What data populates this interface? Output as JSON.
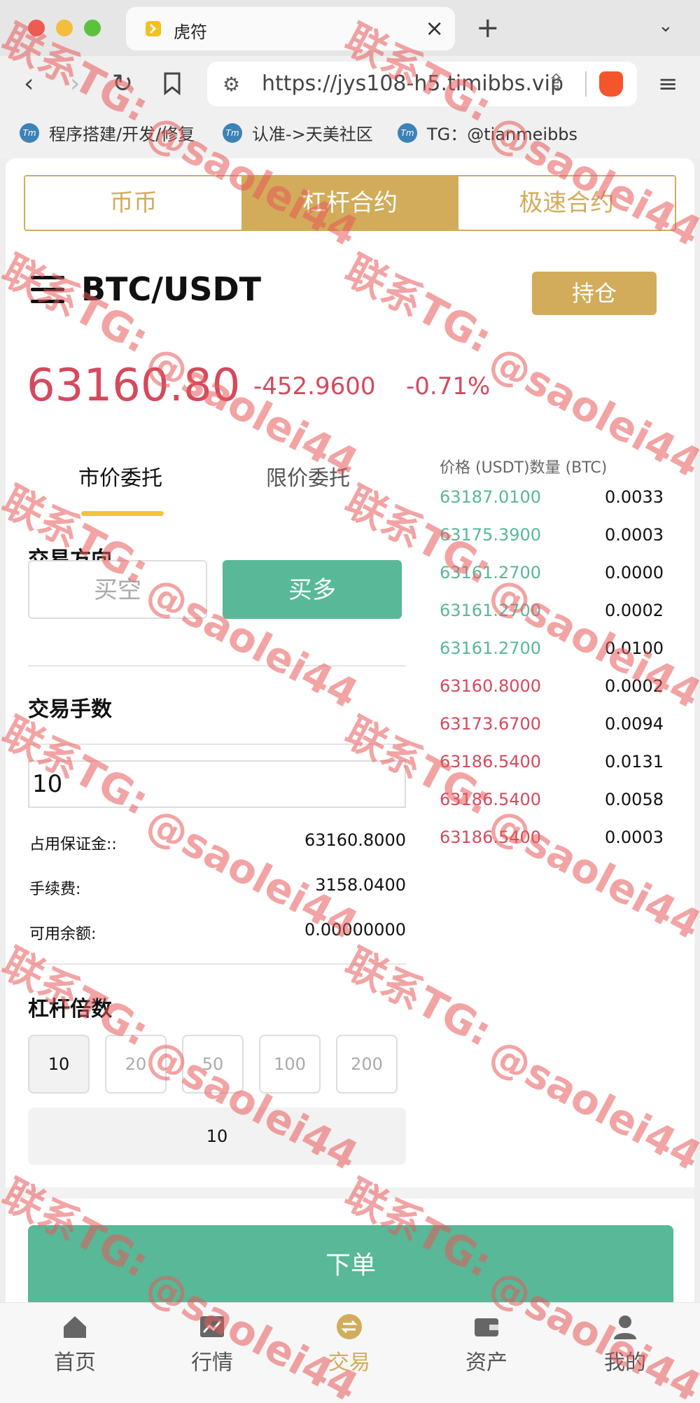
{
  "browser": {
    "tab_title": "虎符",
    "url": "https://jys108-h5.timibbs.vip",
    "bookmarks": [
      {
        "icon": "Tm",
        "label": "程序搭建/开发/修复"
      },
      {
        "icon": "Tm",
        "label": "认准->天美社区"
      },
      {
        "icon": "Tm",
        "label": "TG：@tianmeibbs"
      }
    ]
  },
  "mode_tabs": [
    "币币",
    "杠杆合约",
    "极速合约"
  ],
  "header": {
    "pair": "BTC/USDT",
    "hold_button": "持仓"
  },
  "ticker": {
    "price": "63160.80",
    "change": "-452.9600",
    "change_pct": "-0.71%"
  },
  "order_tabs": [
    "市价委托",
    "限价委托"
  ],
  "direction": {
    "title": "交易方向",
    "short_label": "买空",
    "long_label": "买多"
  },
  "quantity": {
    "title": "交易手数",
    "value": "10"
  },
  "info": {
    "margin_label": "占用保证金::",
    "margin_value": "63160.8000",
    "fee_label": "手续费:",
    "fee_value": "3158.0400",
    "balance_label": "可用余额:",
    "balance_value": "0.00000000"
  },
  "leverage": {
    "title": "杠杆倍数",
    "options": [
      "10",
      "20",
      "50",
      "100",
      "200"
    ],
    "selected": "10"
  },
  "order_book": {
    "header": "价格 (USDT)数量 (BTC)",
    "asks_color": "#58b898",
    "bids_color": "#d44a5c",
    "rows": [
      {
        "price": "63187.0100",
        "qty": "0.0033",
        "side": "green"
      },
      {
        "price": "63175.3900",
        "qty": "0.0003",
        "side": "green"
      },
      {
        "price": "63161.2700",
        "qty": "0.0000",
        "side": "green"
      },
      {
        "price": "63161.2700",
        "qty": "0.0002",
        "side": "green"
      },
      {
        "price": "63161.2700",
        "qty": "0.0100",
        "side": "green"
      },
      {
        "price": "63160.8000",
        "qty": "0.0002",
        "side": "red"
      },
      {
        "price": "63173.6700",
        "qty": "0.0094",
        "side": "red"
      },
      {
        "price": "63186.5400",
        "qty": "0.0131",
        "side": "red"
      },
      {
        "price": "63186.5400",
        "qty": "0.0058",
        "side": "red"
      },
      {
        "price": "63186.5400",
        "qty": "0.0003",
        "side": "red"
      }
    ]
  },
  "submit_label": "下单",
  "bottom_nav": [
    {
      "label": "首页",
      "icon": "home-icon"
    },
    {
      "label": "行情",
      "icon": "chart-icon"
    },
    {
      "label": "交易",
      "icon": "exchange-icon"
    },
    {
      "label": "资产",
      "icon": "wallet-icon"
    },
    {
      "label": "我的",
      "icon": "user-icon"
    }
  ],
  "watermark": {
    "line1": "联系TG:",
    "line2": "@saolei44"
  },
  "colors": {
    "gold": "#d2ac5a",
    "green": "#58b898",
    "red": "#d44a5c"
  }
}
